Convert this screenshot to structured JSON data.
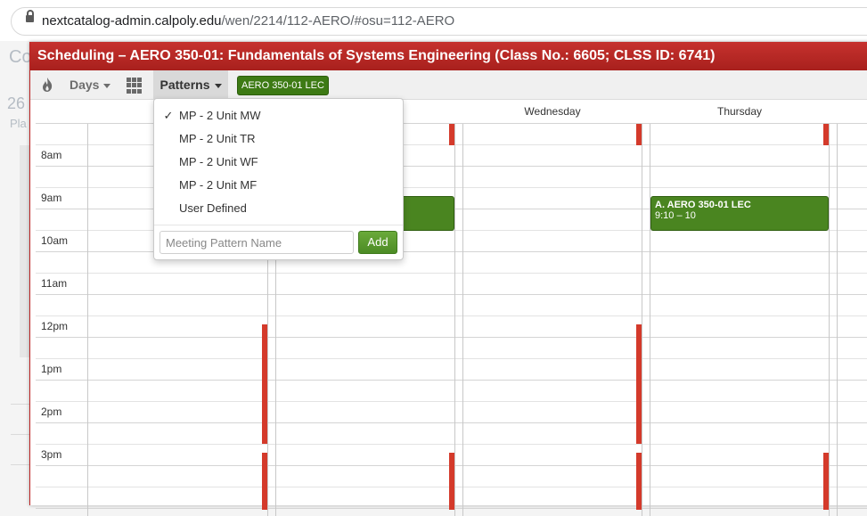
{
  "browser": {
    "url_host": "nextcatalog-admin.calpoly.edu",
    "url_path": "/wen/2214/112-AERO/#osu=112-AERO"
  },
  "background": {
    "heading_fragment": "Co",
    "number_fragment": "26",
    "small_fragment": "Pla"
  },
  "dialog": {
    "title": "Scheduling – AERO 350-01: Fundamentals of Systems Engineering (Class No.: 6605; CLSS ID: 6741)",
    "toolbar": {
      "days_label": "Days",
      "patterns_label": "Patterns",
      "section_tag": "AERO 350-01 LEC"
    }
  },
  "calendar": {
    "day_headers": [
      "Wednesday",
      "Thursday"
    ],
    "times": [
      "8am",
      "9am",
      "10am",
      "11am",
      "12pm",
      "1pm",
      "2pm",
      "3pm"
    ],
    "event": {
      "title": "A. AERO 350-01 LEC",
      "time": "9:10 – 10"
    }
  },
  "patterns_menu": {
    "items": [
      {
        "label": "MP - 2 Unit MW",
        "checked": true
      },
      {
        "label": "MP - 2 Unit TR",
        "checked": false
      },
      {
        "label": "MP - 2 Unit WF",
        "checked": false
      },
      {
        "label": "MP - 2 Unit MF",
        "checked": false
      },
      {
        "label": "User Defined",
        "checked": false
      }
    ],
    "check_mark": "✓",
    "name_placeholder": "Meeting Pattern Name",
    "add_label": "Add"
  },
  "colors": {
    "title_bar": "#b52a26",
    "event_green": "#4a8520",
    "unavailable_red": "#d43a2b"
  }
}
